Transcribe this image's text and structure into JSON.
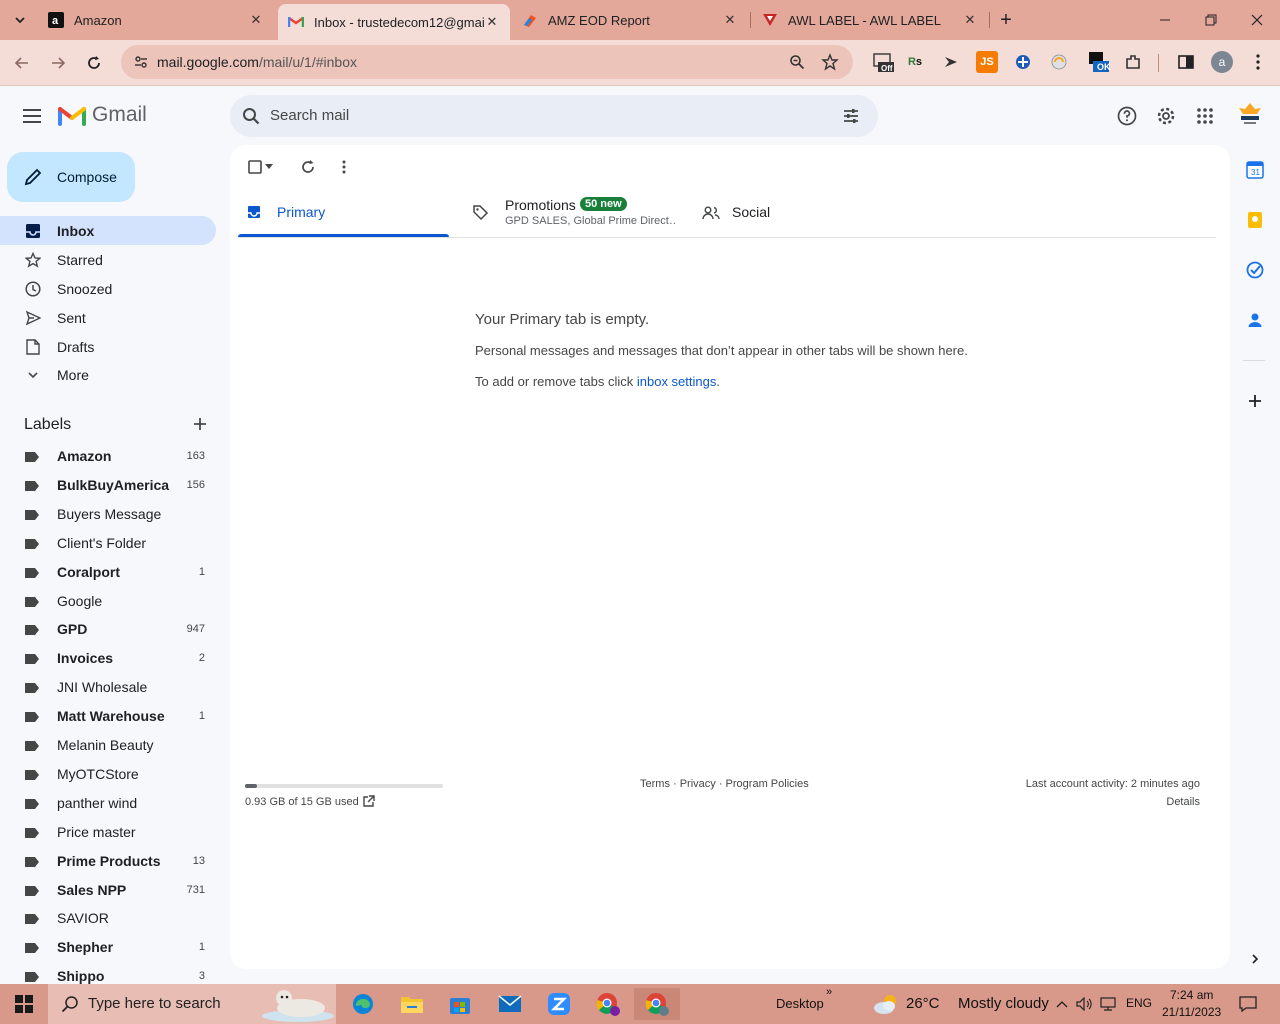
{
  "browser": {
    "tabs": [
      {
        "title": "Amazon",
        "icon": "amazon-icon"
      },
      {
        "title": "Inbox - trustedecom12@gmail.",
        "icon": "gmail-icon"
      },
      {
        "title": "AMZ EOD Report",
        "icon": "sheets-icon"
      },
      {
        "title": "AWL LABEL - AWL LABEL",
        "icon": "awl-icon"
      }
    ],
    "url_host": "mail.google.com",
    "url_path": "/mail/u/1/#inbox",
    "profile_letter": "a",
    "extension_badge_off": "Off",
    "extension_badge_ok": "OK",
    "extension_js": "JS"
  },
  "gmail": {
    "brand": "Gmail",
    "search_placeholder": "Search mail",
    "compose_label": "Compose",
    "nav": [
      {
        "label": "Inbox",
        "icon": "inbox-icon",
        "selected": true
      },
      {
        "label": "Starred",
        "icon": "star-icon"
      },
      {
        "label": "Snoozed",
        "icon": "clock-icon"
      },
      {
        "label": "Sent",
        "icon": "send-icon"
      },
      {
        "label": "Drafts",
        "icon": "draft-icon"
      },
      {
        "label": "More",
        "icon": "chevron-down-icon"
      }
    ],
    "labels_title": "Labels",
    "labels": [
      {
        "name": "Amazon",
        "count": "163",
        "bold": true
      },
      {
        "name": "BulkBuyAmerica",
        "count": "156",
        "bold": true
      },
      {
        "name": "Buyers Message",
        "count": "",
        "bold": false
      },
      {
        "name": "Client's Folder",
        "count": "",
        "bold": false
      },
      {
        "name": "Coralport",
        "count": "1",
        "bold": true
      },
      {
        "name": "Google",
        "count": "",
        "bold": false
      },
      {
        "name": "GPD",
        "count": "947",
        "bold": true
      },
      {
        "name": "Invoices",
        "count": "2",
        "bold": true
      },
      {
        "name": "JNI Wholesale",
        "count": "",
        "bold": false
      },
      {
        "name": "Matt Warehouse",
        "count": "1",
        "bold": true
      },
      {
        "name": "Melanin Beauty",
        "count": "",
        "bold": false
      },
      {
        "name": "MyOTCStore",
        "count": "",
        "bold": false
      },
      {
        "name": "panther wind",
        "count": "",
        "bold": false
      },
      {
        "name": "Price master",
        "count": "",
        "bold": false
      },
      {
        "name": "Prime Products",
        "count": "13",
        "bold": true
      },
      {
        "name": "Sales NPP",
        "count": "731",
        "bold": true
      },
      {
        "name": "SAVIOR",
        "count": "",
        "bold": false
      },
      {
        "name": "Shepher",
        "count": "1",
        "bold": true
      },
      {
        "name": "Shippo",
        "count": "3",
        "bold": true
      }
    ],
    "category_tabs": {
      "primary": "Primary",
      "promotions": "Promotions",
      "promotions_badge": "50 new",
      "promotions_senders": "GPD SALES, Global Prime Direct…",
      "social": "Social"
    },
    "empty": {
      "title": "Your Primary tab is empty.",
      "desc": "Personal messages and messages that don’t appear in other tabs will be shown here.",
      "settings_prefix": "To add or remove tabs click ",
      "settings_link": "inbox settings",
      "settings_suffix": "."
    },
    "storage": {
      "used_text": "0.93 GB of 15 GB used",
      "fraction_used": 0.062
    },
    "footer_links": "Terms · Privacy · Program Policies",
    "last_activity": "Last account activity: 2 minutes ago",
    "details": "Details"
  },
  "taskbar": {
    "search_placeholder": "Type here to search",
    "desktop_label": "Desktop",
    "weather_temp": "26°C",
    "weather_text": "Mostly cloudy",
    "lang": "ENG",
    "time": "7:24 am",
    "date": "21/11/2023"
  },
  "colors": {
    "chrome_tabstrip": "#e3a89a",
    "chrome_toolbar": "#f5ddd7",
    "gmail_selected": "#d3e3fd",
    "compose_bg": "#c2e7ff",
    "badge_green": "#188038",
    "primary_blue": "#0b57d0"
  }
}
